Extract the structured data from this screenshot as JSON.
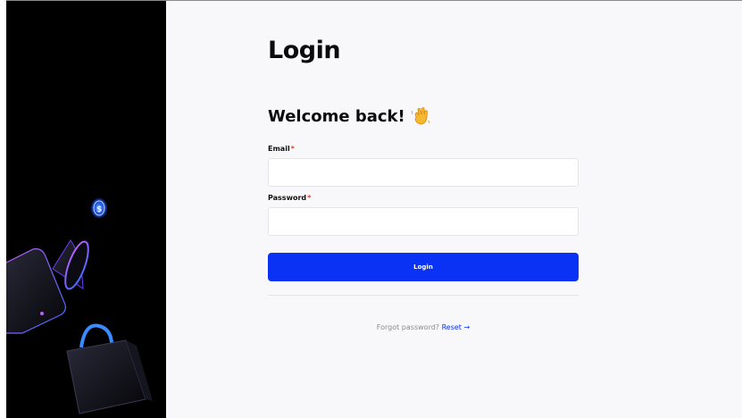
{
  "page": {
    "title": "Login",
    "welcome": "Welcome back!",
    "wave_icon": "waving-hand-icon"
  },
  "form": {
    "email_label": "Email",
    "email_value": "",
    "password_label": "Password",
    "password_value": "",
    "required_marker": "*",
    "submit_label": "Login"
  },
  "footer": {
    "forgot_text": "Forgot password?",
    "reset_label": "Reset →"
  },
  "colors": {
    "accent": "#0a32f5",
    "required": "#e53935",
    "side_panel": "#000000",
    "background": "#f8f8fa"
  },
  "side_panel": {
    "icons": [
      "coin-icon",
      "megaphone-icon",
      "phone-icon",
      "shopping-bag-icon"
    ]
  }
}
